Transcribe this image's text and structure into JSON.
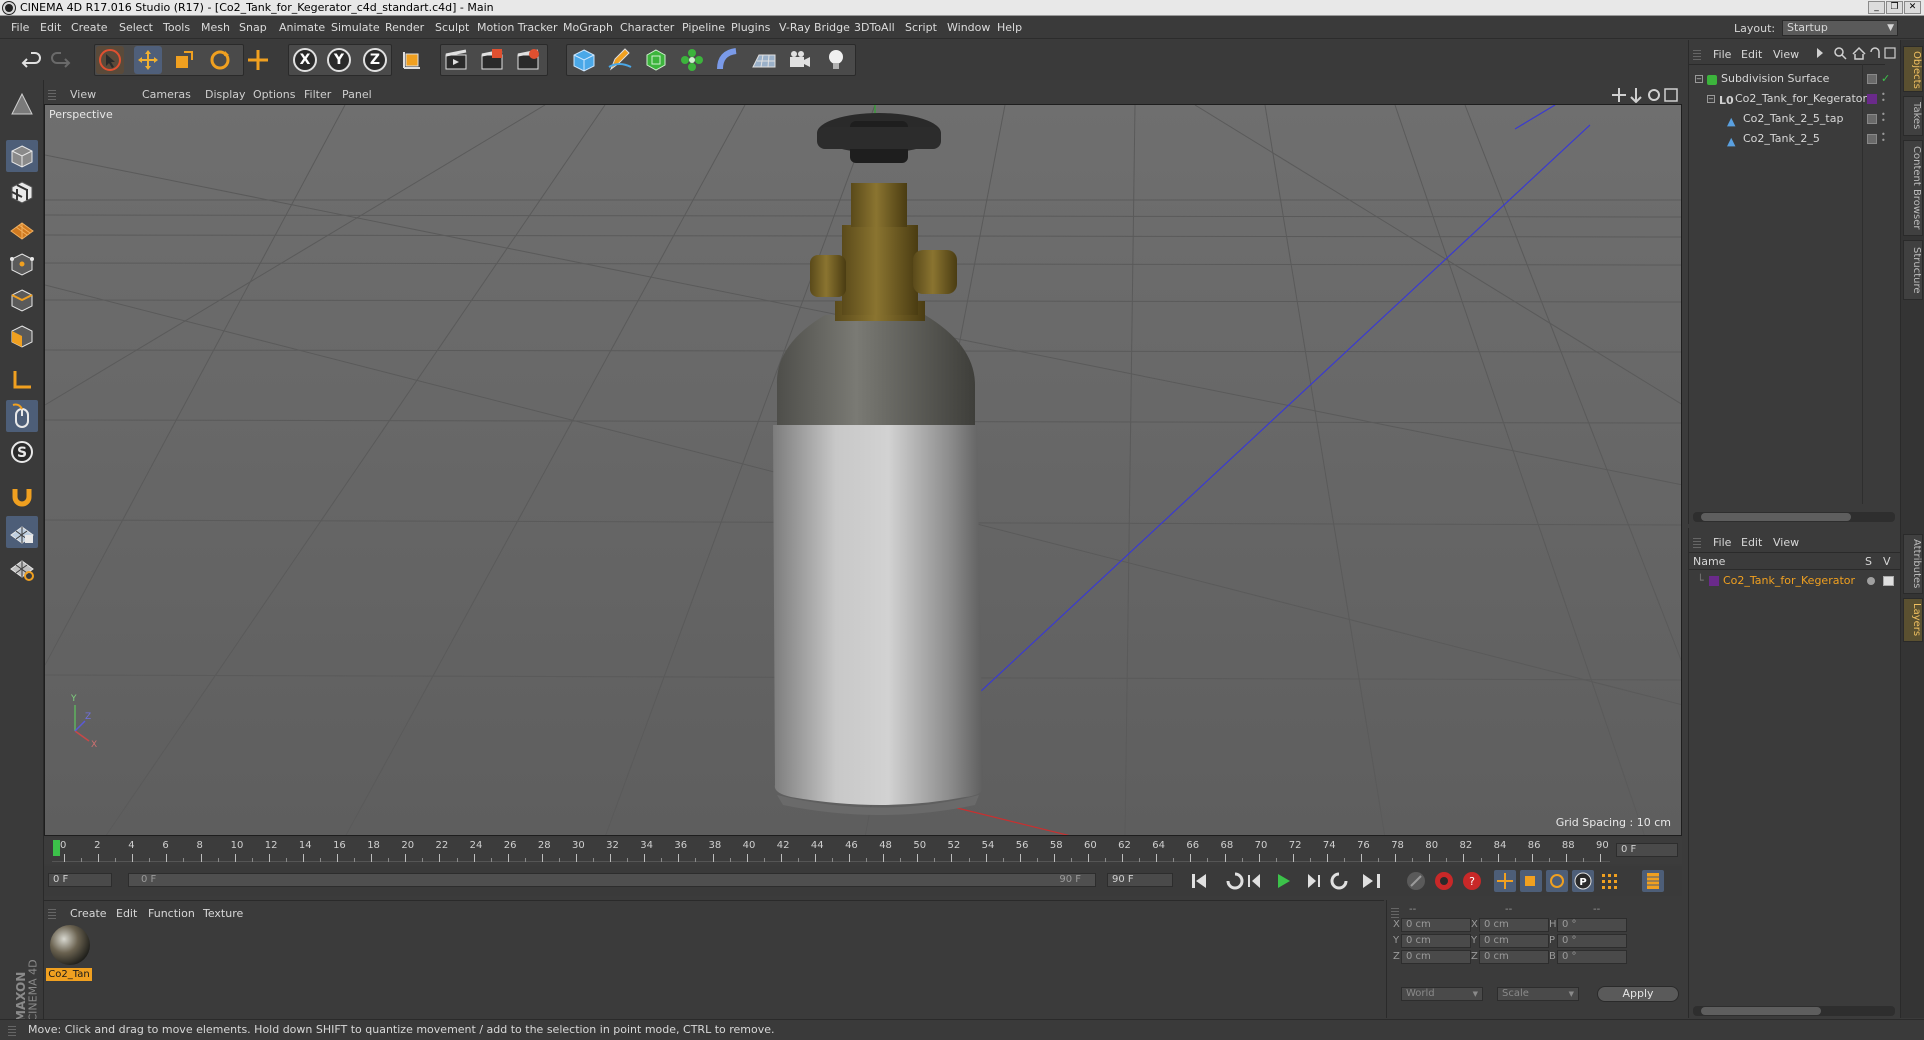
{
  "window": {
    "title": "CINEMA 4D R17.016 Studio (R17) - [Co2_Tank_for_Kegerator_c4d_standart.c4d] - Main",
    "minimize": "_",
    "restore": "❐",
    "close": "✕"
  },
  "menu": [
    "File",
    "Edit",
    "Create",
    "Select",
    "Tools",
    "Mesh",
    "Snap",
    "Animate",
    "Simulate",
    "Render",
    "Sculpt",
    "Motion Tracker",
    "MoGraph",
    "Character",
    "Pipeline",
    "Plugins",
    "V-Ray Bridge",
    "3DToAll",
    "Script",
    "Window",
    "Help"
  ],
  "layout": {
    "label": "Layout:",
    "value": "Startup"
  },
  "toolbar": {
    "undo_icon": "undo-icon",
    "redo_icon": "redo-icon",
    "axis": [
      "X",
      "Y",
      "Z"
    ]
  },
  "viewport": {
    "menu": [
      "View",
      "Cameras",
      "Display",
      "Options",
      "Filter",
      "Panel"
    ],
    "label": "Perspective",
    "grid_spacing": "Grid Spacing : 10 cm"
  },
  "timeline": {
    "ticks": [
      "0",
      "2",
      "4",
      "6",
      "8",
      "10",
      "12",
      "14",
      "16",
      "18",
      "20",
      "22",
      "24",
      "26",
      "28",
      "30",
      "32",
      "34",
      "36",
      "38",
      "40",
      "42",
      "44",
      "46",
      "48",
      "50",
      "52",
      "54",
      "56",
      "58",
      "60",
      "62",
      "64",
      "66",
      "68",
      "70",
      "72",
      "74",
      "76",
      "78",
      "80",
      "82",
      "84",
      "86",
      "88",
      "90"
    ],
    "current": "0 F",
    "start": "0 F",
    "range_start": "0 F",
    "range_end": "90 F",
    "end": "90 F"
  },
  "material_manager": {
    "menu": [
      "Create",
      "Edit",
      "Function",
      "Texture"
    ],
    "material_name": "Co2_Tan"
  },
  "coordinates": {
    "header": [
      "--",
      "--",
      "--"
    ],
    "rows": [
      {
        "a": "X",
        "av": "0 cm",
        "b": "X",
        "bv": "0 cm",
        "c": "H",
        "cv": "0 °"
      },
      {
        "a": "Y",
        "av": "0 cm",
        "b": "Y",
        "bv": "0 cm",
        "c": "P",
        "cv": "0 °"
      },
      {
        "a": "Z",
        "av": "0 cm",
        "b": "Z",
        "bv": "0 cm",
        "c": "B",
        "cv": "0 °"
      }
    ],
    "mode": "World",
    "scale": "Scale",
    "apply": "Apply"
  },
  "object_manager": {
    "menu": [
      "File",
      "Edit",
      "View"
    ],
    "objects": [
      {
        "name": "Subdivision Surface",
        "color": "#3cb43c"
      },
      {
        "name": "Co2_Tank_for_Kegerator",
        "color": "#a0a0a0"
      },
      {
        "name": "Co2_Tank_2_5_tap",
        "color": "#5aa0e0"
      },
      {
        "name": "Co2_Tank_2_5",
        "color": "#5aa0e0"
      }
    ]
  },
  "layer_manager": {
    "menu": [
      "File",
      "Edit",
      "View"
    ],
    "col_name": "Name",
    "col_s": "S",
    "col_v": "V",
    "layers": [
      {
        "name": "Co2_Tank_for_Kegerator",
        "color": "#6a2a8a"
      }
    ]
  },
  "side_tabs_top": [
    "Objects",
    "Takes",
    "Content Browser",
    "Structure"
  ],
  "side_tabs_bottom": [
    "Attributes",
    "Layers"
  ],
  "status": "Move: Click and drag to move elements. Hold down SHIFT to quantize movement / add to the selection in point mode, CTRL to remove.",
  "brand": {
    "line1": "MAXON",
    "line2": "CINEMA 4D"
  },
  "colors": {
    "accent_orange": "#f0a020",
    "viewport_bg": "#6e6e6e",
    "panel_bg": "#3b3b3b"
  }
}
